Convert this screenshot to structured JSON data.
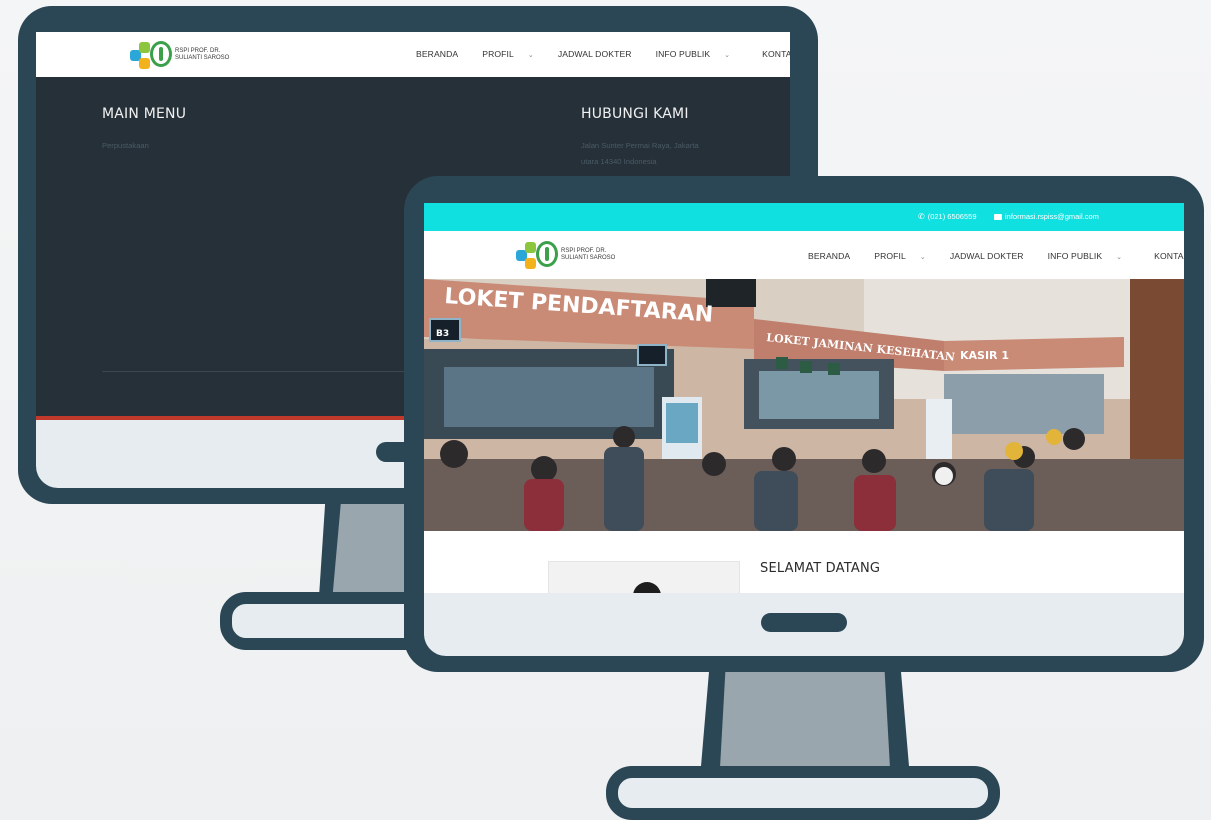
{
  "site": {
    "logo_line1": "RSPI PROF. DR.",
    "logo_line2": "SULIANTI SAROSO",
    "menu": [
      {
        "label": "BERANDA",
        "dropdown": false
      },
      {
        "label": "PROFIL",
        "dropdown": true
      },
      {
        "label": "JADWAL DOKTER",
        "dropdown": false
      },
      {
        "label": "INFO PUBLIK",
        "dropdown": true
      },
      {
        "label": "KONTAK KAMI",
        "dropdown": true
      }
    ]
  },
  "back_monitor": {
    "footer": {
      "main_menu_title": "MAIN MENU",
      "main_menu_item": "Perpustakaan",
      "contact_title": "HUBUNGI KAMI",
      "address_line1": "Jalan Sunter Permai Raya, Jakarta",
      "address_line2": "utara 14340 Indonesia"
    }
  },
  "front_monitor": {
    "topbar": {
      "phone": "(021) 6506559",
      "email": "informasi.rspiss@gmail.com",
      "color": "#11e0e0"
    },
    "hero": {
      "sign_main": "LOKET PENDAFTARAN",
      "sign_secondary": "LOKET JAMINAN KESEHATAN",
      "sign_kasir": "KASIR 1",
      "counter_b3": "B3"
    },
    "welcome_title": "SELAMAT DATANG"
  },
  "colors": {
    "frame": "#2b4655",
    "chin": "#e6ecef",
    "footer_bg": "#263038",
    "accent_teal": "#11e0e0"
  }
}
